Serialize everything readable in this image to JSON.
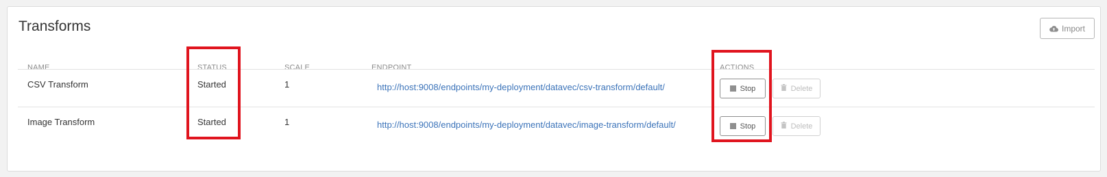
{
  "panel": {
    "title": "Transforms",
    "import_label": "Import"
  },
  "table": {
    "headers": {
      "name": "NAME",
      "status": "STATUS",
      "scale": "SCALE",
      "endpoint": "ENDPOINT",
      "actions": "ACTIONS"
    },
    "rows": [
      {
        "name": "CSV Transform",
        "status": "Started",
        "scale": "1",
        "endpoint": "http://host:9008/endpoints/my-deployment/datavec/csv-transform/default/",
        "stop_label": "Stop",
        "delete_label": "Delete"
      },
      {
        "name": "Image Transform",
        "status": "Started",
        "scale": "1",
        "endpoint": "http://host:9008/endpoints/my-deployment/datavec/image-transform/default/",
        "stop_label": "Stop",
        "delete_label": "Delete"
      }
    ]
  },
  "colors": {
    "link": "#3b73b9",
    "highlight": "#e0141e"
  }
}
